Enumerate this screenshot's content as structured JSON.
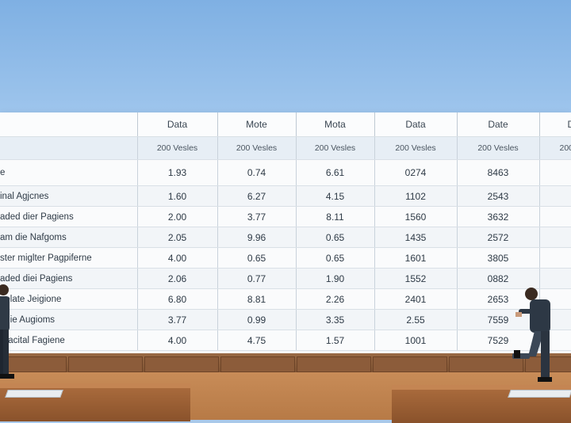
{
  "table": {
    "header_row_1": [
      "",
      "Data",
      "Mote",
      "Mota",
      "Data",
      "Date",
      "D"
    ],
    "header_row_2": [
      "",
      "200 Vesles",
      "200 Vesles",
      "200 Vesles",
      "200 Vesles",
      "200 Vesles",
      "200"
    ],
    "rows": [
      {
        "label": "e",
        "values": [
          "1.93",
          "0.74",
          "6.61",
          "0274",
          "8463",
          ""
        ]
      },
      {
        "label": "inal Agjcnes",
        "values": [
          "1.60",
          "6.27",
          "4.15",
          "1102",
          "2543",
          ""
        ]
      },
      {
        "label": "aded dier Pagiens",
        "values": [
          "2.00",
          "3.77",
          "8.11",
          "1560",
          "3632",
          ""
        ]
      },
      {
        "label": "am die Nafgoms",
        "values": [
          "2.05",
          "9.96",
          "0.65",
          "1435",
          "2572",
          ""
        ]
      },
      {
        "label": "ster miglter Pagpiferne",
        "values": [
          "4.00",
          "0.65",
          "0.65",
          "1601",
          "3805",
          ""
        ]
      },
      {
        "label": "aded diei Pagiens",
        "values": [
          "2.06",
          "0.77",
          "1.90",
          "1552",
          "0882",
          ""
        ]
      },
      {
        "label": "eelate Jeigione",
        "values": [
          "6.80",
          "8.81",
          "2.26",
          "2401",
          "2653",
          ""
        ]
      },
      {
        "label": "edie Augioms",
        "values": [
          "3.77",
          "0.99",
          "3.35",
          "2.55",
          "7559",
          ""
        ]
      },
      {
        "label": "oracital Fagiene",
        "values": [
          "4.00",
          "4.75",
          "1.57",
          "1001",
          "7529",
          ""
        ]
      }
    ]
  }
}
